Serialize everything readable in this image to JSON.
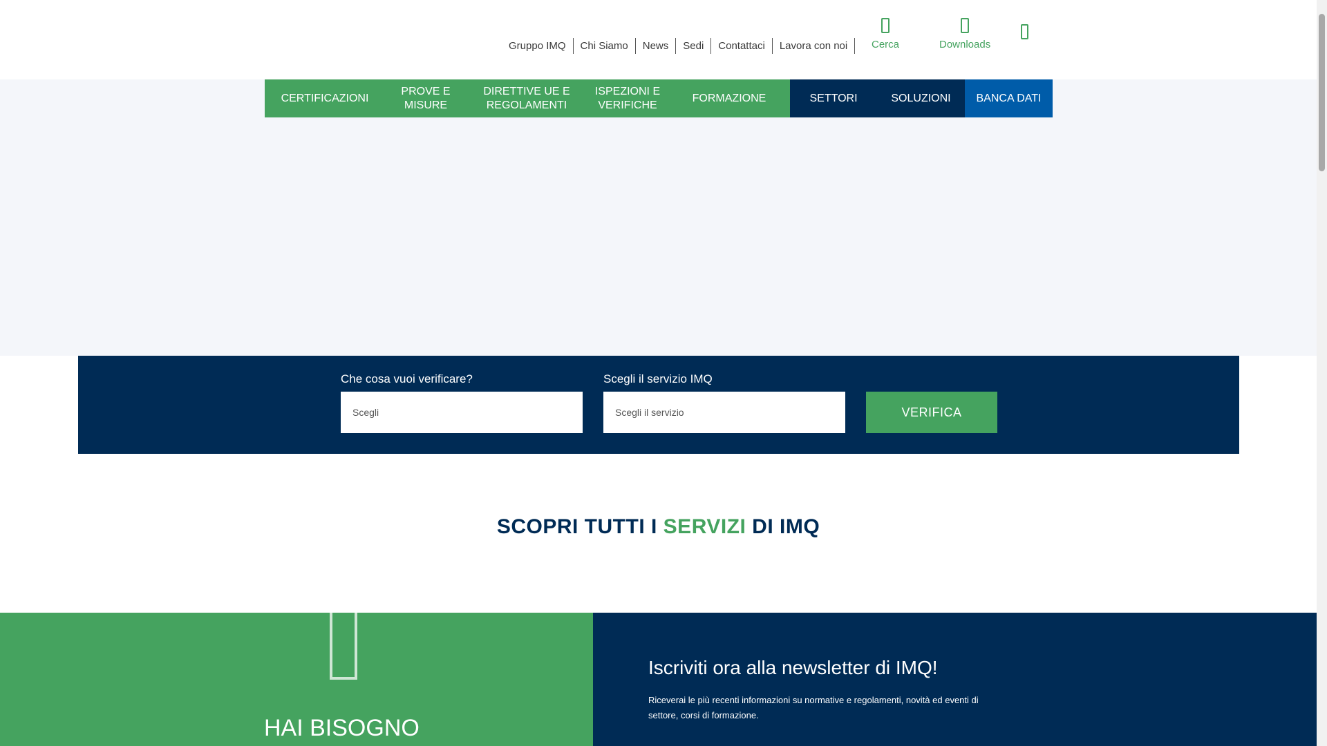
{
  "header": {
    "top_links": [
      "Gruppo IMQ",
      "Chi Siamo",
      "News",
      "Sedi",
      "Contattaci",
      "Lavora con noi"
    ],
    "search_label": "Cerca",
    "downloads_label": "Downloads"
  },
  "nav": {
    "certificazioni": "CERTIFICAZIONI",
    "prove_line1": "PROVE E",
    "prove_line2": "MISURE",
    "direttive_line1": "DIRETTIVE UE E",
    "direttive_line2": "REGOLAMENTI",
    "ispezioni_line1": "ISPEZIONI E",
    "ispezioni_line2": "VERIFICHE",
    "formazione": "FORMAZIONE",
    "settori": "SETTORI",
    "soluzioni": "SOLUZIONI",
    "banca_dati": "BANCA DATI"
  },
  "verify": {
    "what_label": "Che cosa vuoi verificare?",
    "what_placeholder": "Scegli",
    "service_label": "Scegli il servizio IMQ",
    "service_placeholder": "Scegli il servizio",
    "button_label": "VERIFICA"
  },
  "services_title": {
    "part1": "SCOPRI TUTTI I ",
    "accent": "SERVIZI",
    "part2": " DI IMQ"
  },
  "help": {
    "title": "HAI BISOGNO"
  },
  "newsletter": {
    "title": "Iscriviti ora alla newsletter di IMQ!",
    "text": "Riceverai le più recenti informazioni su normative e regolamenti, novità ed eventi di settore, corsi di formazione."
  },
  "colors": {
    "green": "#45a35f",
    "navy": "#002b55",
    "blue": "#005ca9"
  }
}
